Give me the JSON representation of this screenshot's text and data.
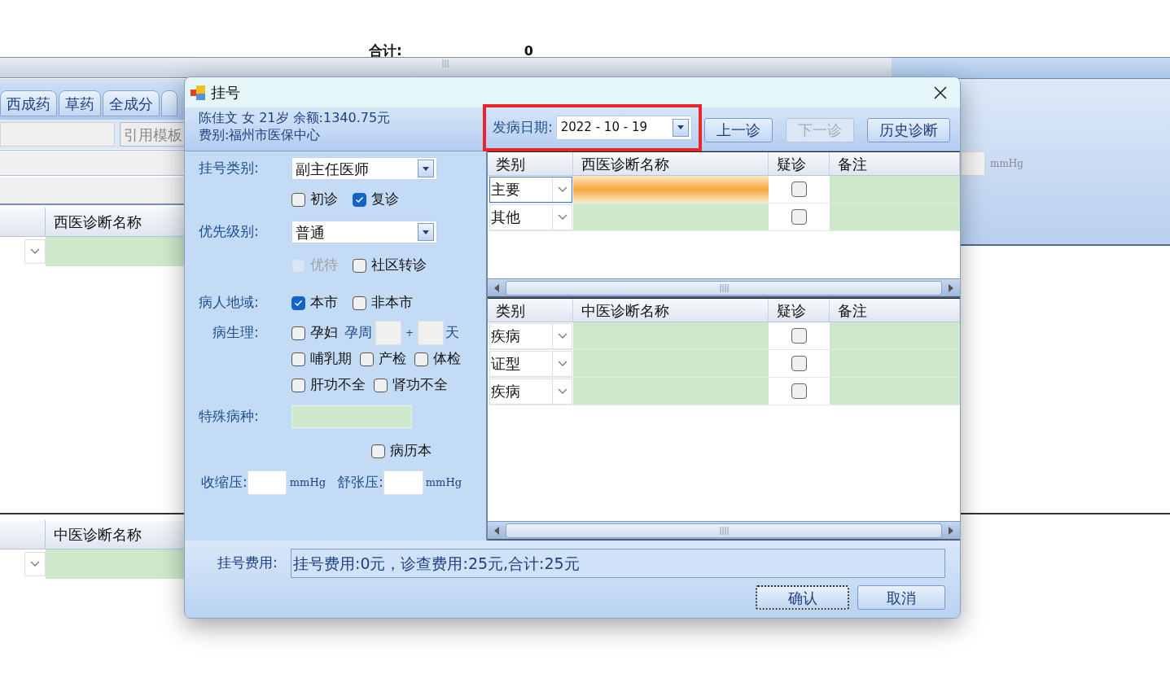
{
  "background": {
    "total_label": "合计:",
    "total_value": "0",
    "tabs": [
      {
        "label": "西成药",
        "selected": false
      },
      {
        "label": "草药",
        "selected": false
      },
      {
        "label": "全成分",
        "selected": false
      }
    ],
    "template_button": "引用模板",
    "unit": "mmHg",
    "western_header": "西医诊断名称",
    "tcm_header": "中医诊断名称"
  },
  "dialog": {
    "title": "挂号",
    "patient_line1": "陈佳文 女 21岁 余额:1340.75元",
    "patient_line2": "费别:福州市医保中心",
    "onset": {
      "label": "发病日期:",
      "value": "2022 - 10 - 19",
      "highlighted": true
    },
    "buttons": [
      {
        "label": "上一诊",
        "disabled": false
      },
      {
        "label": "下一诊",
        "disabled": true
      },
      {
        "label": "历史诊断",
        "disabled": false
      }
    ],
    "reg_type": {
      "label": "挂号类别:",
      "value": "副主任医师"
    },
    "visit": [
      {
        "label": "初诊",
        "checked": false,
        "disabled": false
      },
      {
        "label": "复诊",
        "checked": true,
        "disabled": false
      }
    ],
    "priority": {
      "label": "优先级别:",
      "value": "普通"
    },
    "priority_flags": [
      {
        "label": "优待",
        "checked": false,
        "disabled": true
      },
      {
        "label": "社区转诊",
        "checked": false,
        "disabled": false
      }
    ],
    "region": {
      "label": "病人地域:",
      "options": [
        {
          "label": "本市",
          "checked": true,
          "disabled": false
        },
        {
          "label": "非本市",
          "checked": false,
          "disabled": false
        }
      ]
    },
    "physiology": {
      "label": "病生理:",
      "pregnant": {
        "label": "孕妇",
        "checked": false,
        "disabled": false
      },
      "week_label": "孕周",
      "plus": "+",
      "day_label": "天",
      "row2": [
        {
          "label": "哺乳期",
          "checked": false,
          "disabled": false
        },
        {
          "label": "产检",
          "checked": false,
          "disabled": false
        },
        {
          "label": "体检",
          "checked": false,
          "disabled": false
        }
      ],
      "row3": [
        {
          "label": "肝功不全",
          "checked": false,
          "disabled": false
        },
        {
          "label": "肾功不全",
          "checked": false,
          "disabled": false
        }
      ]
    },
    "special_disease": {
      "label": "特殊病种:"
    },
    "record_book": {
      "label": "病历本",
      "checked": false,
      "disabled": false
    },
    "systolic": {
      "label": "收缩压:",
      "unit": "mmHg"
    },
    "diastolic": {
      "label": "舒张压:",
      "unit": "mmHg"
    },
    "western_table": {
      "columns": [
        "类别",
        "西医诊断名称",
        "疑诊",
        "备注"
      ],
      "rows": [
        {
          "category": "主要",
          "suspected": false,
          "selected": true
        },
        {
          "category": "其他",
          "suspected": false,
          "selected": false
        }
      ]
    },
    "tcm_table": {
      "columns": [
        "类别",
        "中医诊断名称",
        "疑诊",
        "备注"
      ],
      "rows": [
        {
          "category": "疾病",
          "suspected": false,
          "selected": false
        },
        {
          "category": "证型",
          "suspected": false,
          "selected": false
        },
        {
          "category": "疾病",
          "suspected": false,
          "selected": false
        }
      ]
    },
    "fee": {
      "label": "挂号费用:",
      "value": "挂号费用:0元，诊查费用:25元,合计:25元"
    },
    "ok_button": "确认",
    "cancel_button": "取消"
  }
}
